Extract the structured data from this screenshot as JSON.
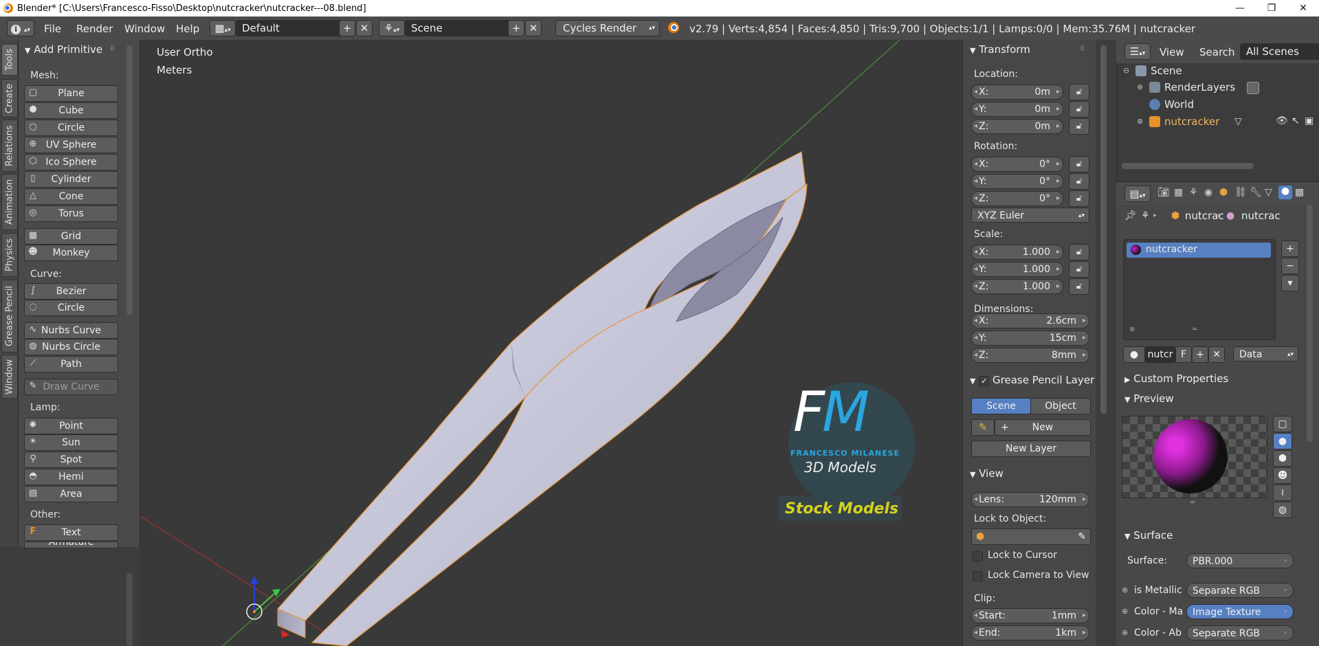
{
  "window": {
    "title": "Blender* [C:\\Users\\Francesco-Fisso\\Desktop\\nutcracker\\nutcracker---08.blend]",
    "controls": [
      "—",
      "❐",
      "✕"
    ]
  },
  "menubar": {
    "info_icon": "i",
    "menus": [
      "File",
      "Render",
      "Window",
      "Help"
    ],
    "layout": "Default",
    "scene": "Scene",
    "engine": "Cycles Render",
    "stats": "v2.79 | Verts:4,854 | Faces:4,850 | Tris:9,700 | Objects:1/1 | Lamps:0/0 | Mem:35.76M | nutcracker"
  },
  "tabs": [
    "Tools",
    "Create",
    "Relations",
    "Animation",
    "Physics",
    "Grease Pencil",
    "Window"
  ],
  "toolshelf": {
    "title": "Add Primitive",
    "mesh_label": "Mesh:",
    "mesh": [
      "Plane",
      "Cube",
      "Circle",
      "UV Sphere",
      "Ico Sphere",
      "Cylinder",
      "Cone",
      "Torus"
    ],
    "mesh2": [
      "Grid",
      "Monkey"
    ],
    "curve_label": "Curve:",
    "curve": [
      "Bezier",
      "Circle"
    ],
    "curve2": [
      "Nurbs Curve",
      "Nurbs Circle",
      "Path"
    ],
    "draw_curve": "Draw Curve",
    "lamp_label": "Lamp:",
    "lamp": [
      "Point",
      "Sun",
      "Spot",
      "Hemi",
      "Area"
    ],
    "other_label": "Other:",
    "other": [
      "Text",
      "Armature"
    ]
  },
  "viewport": {
    "view_name": "User Ortho",
    "units": "Meters",
    "logo_letters": "FM",
    "logo_name": "FRANCESCO MILANESE",
    "logo_sub": "3D Models",
    "logo_tag": "Stock Models"
  },
  "npanel": {
    "transform_title": "Transform",
    "location_label": "Location:",
    "location": {
      "x": "0m",
      "y": "0m",
      "z": "0m"
    },
    "rotation_label": "Rotation:",
    "rotation": {
      "x": "0°",
      "y": "0°",
      "z": "0°"
    },
    "rotation_mode": "XYZ Euler",
    "scale_label": "Scale:",
    "scale": {
      "x": "1.000",
      "y": "1.000",
      "z": "1.000"
    },
    "dimensions_label": "Dimensions:",
    "dimensions": {
      "x": "2.6cm",
      "y": "15cm",
      "z": "8mm"
    },
    "axis_labels": {
      "x": "X:",
      "y": "Y:",
      "z": "Z:"
    },
    "gp_title": "Grease Pencil Layer",
    "gp_scene": "Scene",
    "gp_object": "Object",
    "gp_new": "New",
    "gp_new_layer": "New Layer",
    "view_title": "View",
    "lens_label": "Lens:",
    "lens": "120mm",
    "lock_object_label": "Lock to Object:",
    "lock_cursor": "Lock to Cursor",
    "lock_camera": "Lock Camera to View",
    "clip_label": "Clip:",
    "clip_start_label": "Start:",
    "clip_start": "1mm",
    "clip_end_label": "End:",
    "clip_end": "1km"
  },
  "outliner": {
    "menus": [
      "View",
      "Search"
    ],
    "filter": "All Scenes",
    "items": [
      "Scene",
      "RenderLayers",
      "World",
      "nutcracker"
    ]
  },
  "properties": {
    "breadcrumb_obj": "nutcrac",
    "breadcrumb_mat": "nutcrac",
    "material": "nutcracker",
    "mat_field": "nutcr",
    "mat_f": "F",
    "link": "Data",
    "custom_props": "Custom Properties",
    "preview": "Preview",
    "surface_title": "Surface",
    "surface_label": "Surface:",
    "surface_value": "PBR.000",
    "rows": [
      {
        "label": "is Metallic",
        "value": "Separate RGB"
      },
      {
        "label": "Color - Ma",
        "value": "Image Texture"
      },
      {
        "label": "Color - Ab",
        "value": "Separate RGB"
      }
    ]
  },
  "colors": {
    "accent": "#5680c2",
    "selection_outline": "#e8922c",
    "logo_blue": "#2aa6e0",
    "logo_yellow": "#d6d21e"
  }
}
